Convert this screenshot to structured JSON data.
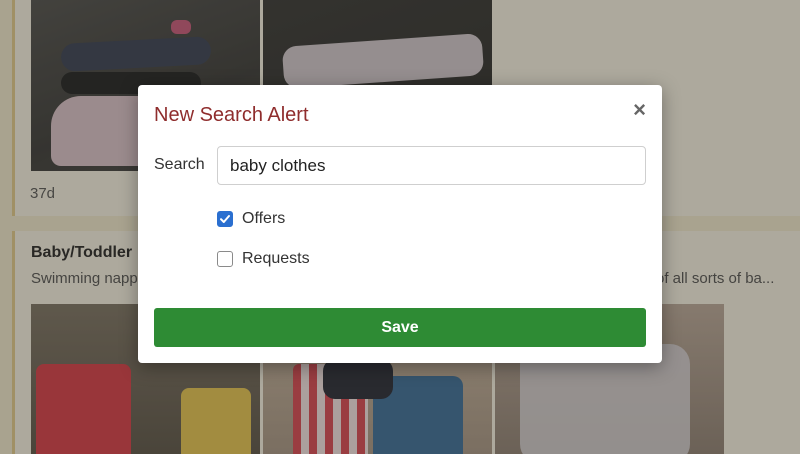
{
  "background": {
    "listing_1": {
      "time_ago": "37d"
    },
    "listing_2": {
      "title": "Baby/Toddler",
      "description": "Swimming napp",
      "description_tail": "of all sorts of ba..."
    }
  },
  "modal": {
    "title": "New Search Alert",
    "close_label": "×",
    "search_label": "Search",
    "search_value": "baby clothes",
    "options": [
      {
        "label": "Offers",
        "checked": true
      },
      {
        "label": "Requests",
        "checked": false
      }
    ],
    "save_label": "Save"
  },
  "colors": {
    "title": "#8f2d2d",
    "save_button": "#2e8b34",
    "checkbox_checked": "#2a6fd0"
  }
}
